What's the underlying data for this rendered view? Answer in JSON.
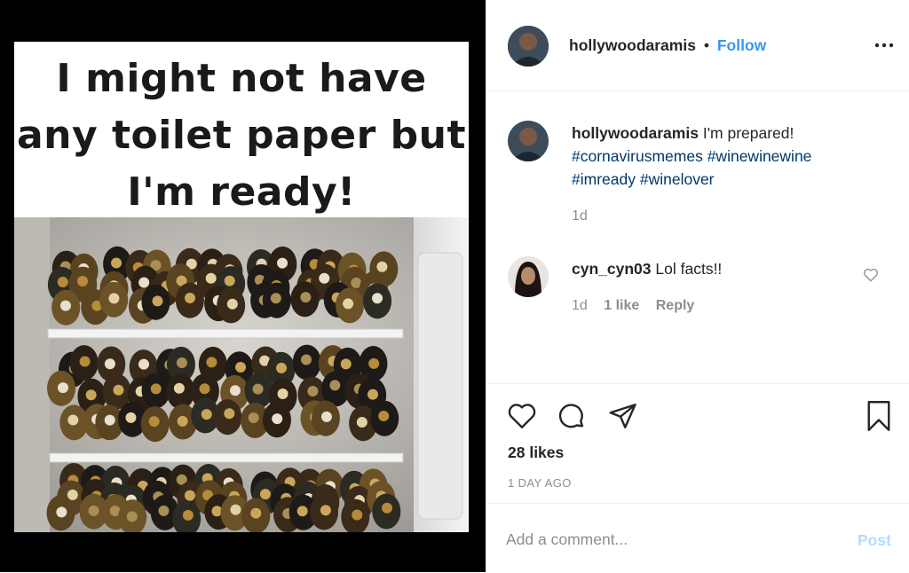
{
  "post": {
    "meme_caption": "I might not have any toilet paper but I'm ready!"
  },
  "header": {
    "username": "hollywoodaramis",
    "separator": "•",
    "follow_label": "Follow",
    "more_icon": "more-horizontal-icon"
  },
  "caption": {
    "username": "hollywoodaramis",
    "text": "I'm prepared!",
    "hashtags": [
      "#cornavirusmemes",
      "#winewinewine",
      "#imready",
      "#winelover"
    ],
    "time": "1d"
  },
  "comments": [
    {
      "username": "cyn_cyn03",
      "text": "Lol facts!!",
      "time": "1d",
      "likes": "1 like",
      "reply_label": "Reply",
      "like_icon": "heart-outline-icon"
    }
  ],
  "actions": {
    "like_icon": "heart-icon",
    "comment_icon": "comment-icon",
    "share_icon": "send-icon",
    "save_icon": "bookmark-icon",
    "likes_count": "28 likes",
    "date": "1 DAY AGO"
  },
  "add_comment": {
    "placeholder": "Add a comment...",
    "post_label": "Post"
  },
  "colors": {
    "link": "#3897f0",
    "hashtag": "#00376b",
    "muted": "#8e8e8e",
    "text": "#262626"
  }
}
